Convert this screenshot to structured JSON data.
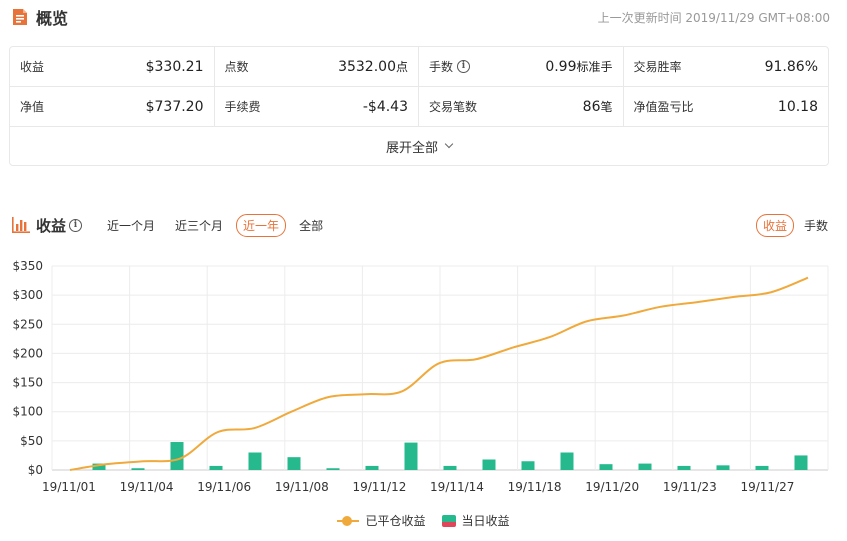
{
  "overview": {
    "title": "概览",
    "last_update": "上一次更新时间 2019/11/29 GMT+08:00",
    "stats": [
      {
        "label": "收益",
        "value": "$330.21",
        "unit": ""
      },
      {
        "label": "点数",
        "value": "3532.00",
        "unit": "点"
      },
      {
        "label": "手数",
        "value": "0.99",
        "unit": "标准手",
        "info": true
      },
      {
        "label": "交易胜率",
        "value": "91.86%",
        "unit": ""
      },
      {
        "label": "净值",
        "value": "$737.20",
        "unit": ""
      },
      {
        "label": "手续费",
        "value": "-$4.43",
        "unit": ""
      },
      {
        "label": "交易笔数",
        "value": "86",
        "unit": "笔"
      },
      {
        "label": "净值盈亏比",
        "value": "10.18",
        "unit": ""
      }
    ],
    "expand_label": "展开全部"
  },
  "earnings": {
    "title": "收益",
    "ranges": [
      "近一个月",
      "近三个月",
      "近一年",
      "全部"
    ],
    "active_range": "近一年",
    "metrics": [
      "收益",
      "手数"
    ],
    "active_metric": "收益"
  },
  "colors": {
    "accent": "#e8733a",
    "line": "#f0a93b",
    "bar": "#25b98d",
    "bar_loss": "#e0455a"
  },
  "chart_data": {
    "type": "bar",
    "x_ticks": [
      "19/11/01",
      "19/11/04",
      "19/11/06",
      "19/11/08",
      "19/11/12",
      "19/11/14",
      "19/11/18",
      "19/11/20",
      "19/11/23",
      "19/11/27"
    ],
    "y_ticks": [
      "$0",
      "$50",
      "$100",
      "$150",
      "$200",
      "$250",
      "$300",
      "$350"
    ],
    "ylim": [
      0,
      350
    ],
    "grid": true,
    "legend_position": "bottom",
    "series": [
      {
        "name": "已平仓收益",
        "type": "line",
        "values": [
          0,
          10,
          15,
          20,
          65,
          72,
          100,
          125,
          130,
          135,
          183,
          190,
          210,
          228,
          255,
          265,
          280,
          288,
          297,
          305,
          330
        ]
      },
      {
        "name": "当日收益",
        "type": "bar",
        "values": [
          11,
          3,
          48,
          7,
          30,
          22,
          3,
          7,
          47,
          7,
          18,
          15,
          30,
          10,
          11,
          7,
          8,
          7,
          25
        ]
      }
    ]
  }
}
